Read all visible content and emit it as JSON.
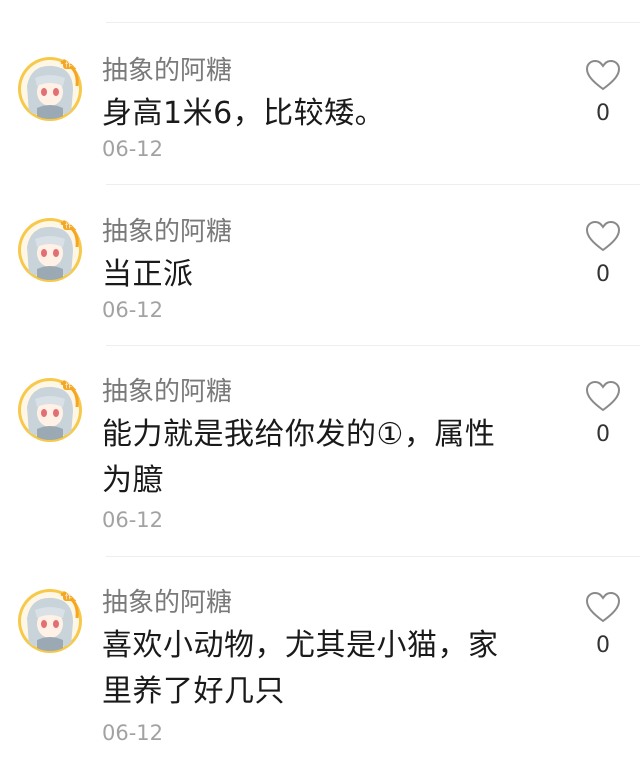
{
  "comments": [
    {
      "author": "抽象的阿糖",
      "text": "身高1米6，比较矮。",
      "date": "06-12",
      "likes": "0",
      "author_badge": "作者"
    },
    {
      "author": "抽象的阿糖",
      "text": "当正派",
      "date": "06-12",
      "likes": "0",
      "author_badge": "作者"
    },
    {
      "author": "抽象的阿糖",
      "text": "能力就是我给你发的①，属性为臆",
      "date": "06-12",
      "likes": "0",
      "author_badge": "作者"
    },
    {
      "author": "抽象的阿糖",
      "text": "喜欢小动物，尤其是小猫，家里养了好几只",
      "date": "06-12",
      "likes": "0",
      "author_badge": "作者"
    }
  ],
  "colors": {
    "author": "#7a7a7a",
    "text": "#1a1a1a",
    "date": "#a2a2a2",
    "divider": "#eeeeee",
    "badge": "#f5a623"
  },
  "icons": {
    "like": "heart-outline-icon",
    "avatar": "anime-girl-avatar"
  }
}
